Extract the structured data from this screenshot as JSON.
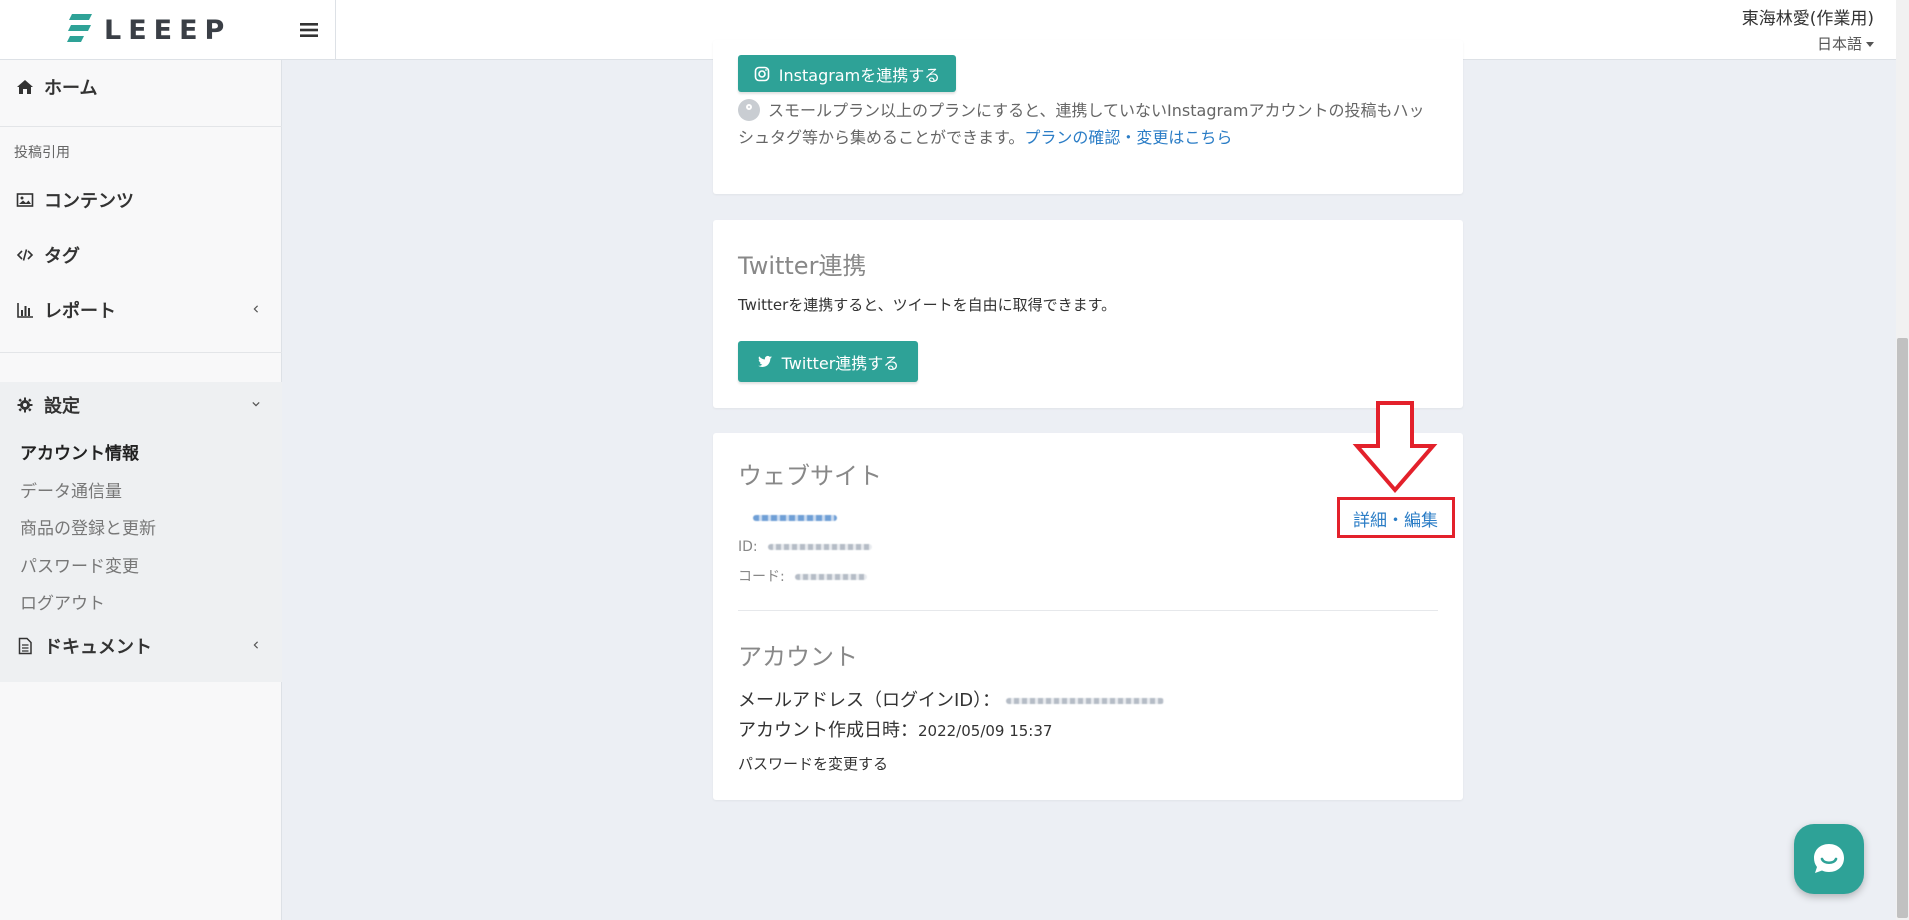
{
  "header": {
    "logo_text": "LEEEP",
    "user_name": "東海林愛(作業用)",
    "language": "日本語"
  },
  "sidebar": {
    "home": "ホーム",
    "section_label": "投稿引用",
    "contents": "コンテンツ",
    "tags": "タグ",
    "reports": "レポート",
    "settings": "設定",
    "settings_items": [
      {
        "label": "アカウント情報",
        "active": true
      },
      {
        "label": "データ通信量",
        "active": false
      },
      {
        "label": "商品の登録と更新",
        "active": false
      },
      {
        "label": "パスワード変更",
        "active": false
      },
      {
        "label": "ログアウト",
        "active": false
      }
    ],
    "documents": "ドキュメント"
  },
  "instagram": {
    "button_label": "Instagramを連携する",
    "note_text": "スモールプラン以上のプランにすると、連携していないInstagramアカウントの投稿もハッシュタグ等から集めることができます。",
    "plan_link": "プランの確認・変更はこちら"
  },
  "twitter": {
    "title": "Twitter連携",
    "description": "Twitterを連携すると、ツイートを自由に取得できます。",
    "button_label": "Twitter連携する"
  },
  "website": {
    "title": "ウェブサイト",
    "id_label": "ID:",
    "code_label": "コード:",
    "edit_link": "詳細・編集"
  },
  "account": {
    "title": "アカウント",
    "email_label": "メールアドレス（ログインID）：",
    "created_label": "アカウント作成日時：",
    "created_value": "2022/05/09 15:37",
    "change_password_link": "パスワードを変更する"
  },
  "colors": {
    "accent": "#2ea297",
    "link": "#2b7dc6",
    "annotation": "#e3212b"
  }
}
